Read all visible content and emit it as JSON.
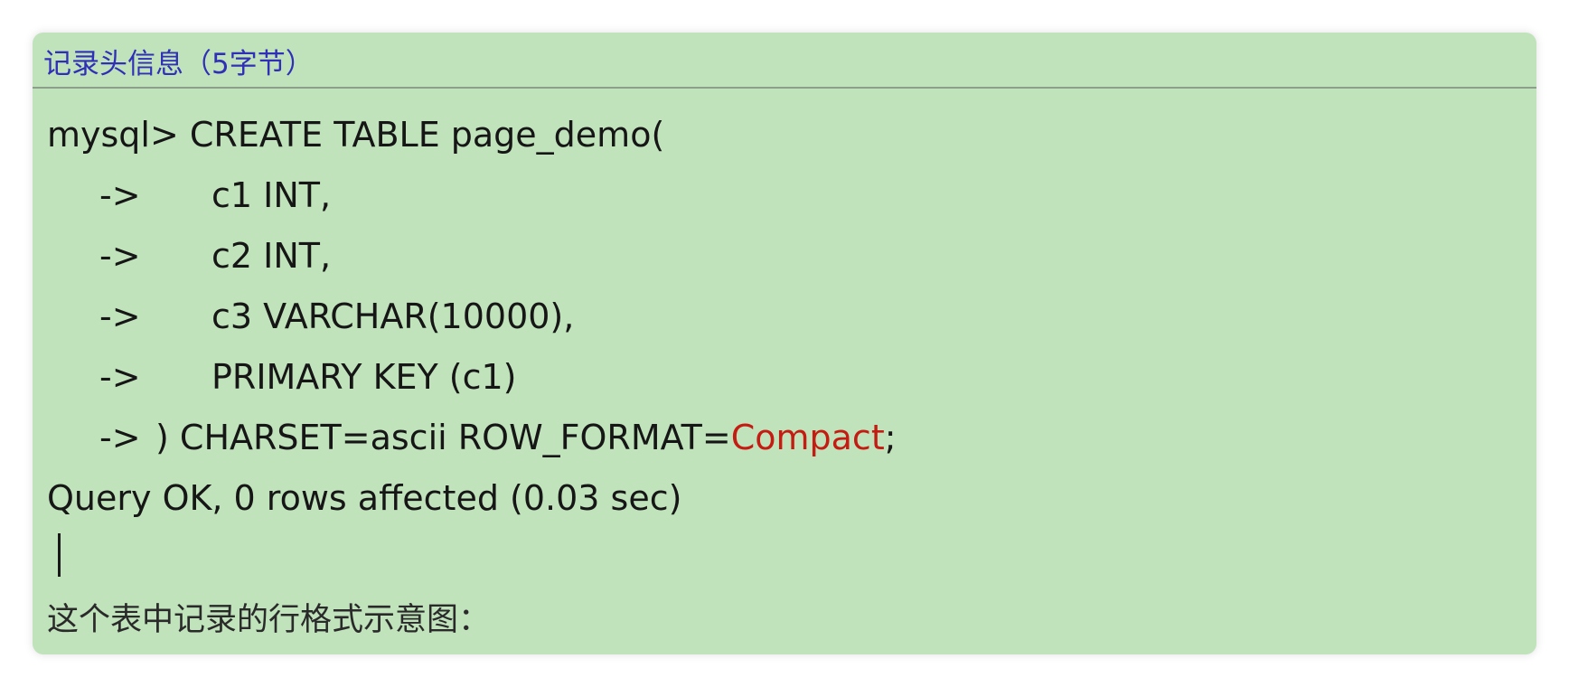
{
  "heading": "记录头信息（5字节）",
  "code": {
    "line1": "mysql> CREATE TABLE page_demo(",
    "arrow": "->",
    "line2": "c1 INT,",
    "line3": "c2 INT,",
    "line4": "c3 VARCHAR(10000),",
    "line5": "PRIMARY KEY (c1)",
    "line6_prefix": ") CHARSET=ascii ROW_FORMAT=",
    "line6_keyword": "Compact",
    "line6_suffix": ";",
    "result": "Query OK, 0 rows affected (0.03 sec)"
  },
  "caption": "这个表中记录的行格式示意图：",
  "colors": {
    "background": "#c0e3bb",
    "heading": "#2f2fb8",
    "highlight": "#c41c12"
  }
}
